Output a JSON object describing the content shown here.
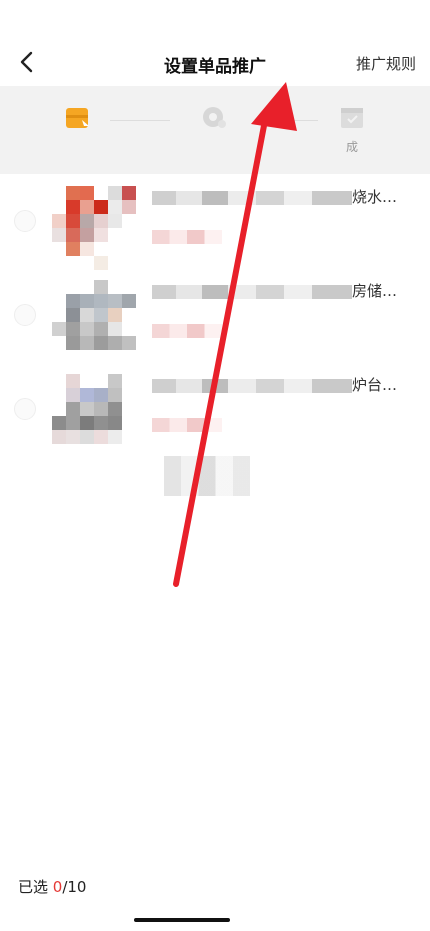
{
  "header": {
    "title": "设置单品推广",
    "rules_label": "推广规则"
  },
  "steps": [
    {
      "label": "",
      "icon": "package-icon",
      "active": true
    },
    {
      "label": "",
      "icon": "gear-icon",
      "active": false
    },
    {
      "label": "成",
      "icon": "completed-box-icon",
      "active": false
    }
  ],
  "products": [
    {
      "title_suffix": "烧水…"
    },
    {
      "title_suffix": "房储…"
    },
    {
      "title_suffix": "炉台…"
    }
  ],
  "footer": {
    "selected_prefix": "已选 ",
    "selected_count": "0",
    "selected_max": "/10"
  },
  "colors": {
    "accent": "#e53935",
    "active_step": "#f5a623",
    "arrow": "#e8202a"
  }
}
